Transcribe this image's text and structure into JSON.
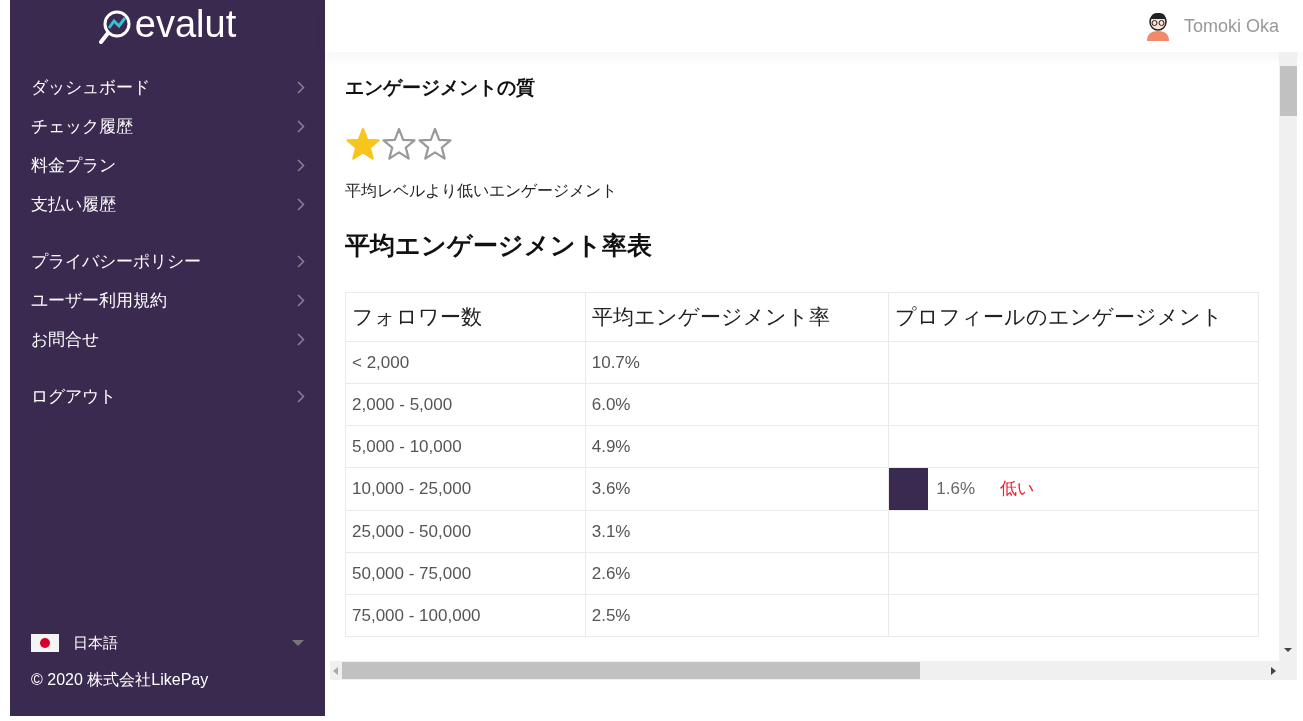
{
  "sidebar": {
    "logo": "evalut",
    "nav_groups": [
      [
        {
          "label": "ダッシュボード"
        },
        {
          "label": "チェック履歴"
        },
        {
          "label": "料金プラン"
        },
        {
          "label": "支払い履歴"
        }
      ],
      [
        {
          "label": "プライバシーポリシー"
        },
        {
          "label": "ユーザー利用規約"
        },
        {
          "label": "お問合せ"
        }
      ],
      [
        {
          "label": "ログアウト"
        }
      ]
    ],
    "language": "日本語",
    "copyright": "© 2020 株式会社LikePay"
  },
  "header": {
    "user_name": "Tomoki Oka"
  },
  "quality": {
    "title": "エンゲージメントの質",
    "stars": 1,
    "description": "平均レベルより低いエンゲージメント"
  },
  "table": {
    "title": "平均エンゲージメント率表",
    "columns": [
      "フォロワー数",
      "平均エンゲージメント率",
      "プロフィールのエンゲージメント"
    ],
    "rows": [
      {
        "followers": "< 2,000",
        "average": "10.7%"
      },
      {
        "followers": "2,000 - 5,000",
        "average": "6.0%"
      },
      {
        "followers": "5,000 - 10,000",
        "average": "4.9%"
      },
      {
        "followers": "10,000 - 25,000",
        "average": "3.6%",
        "profile": {
          "value": "1.6%",
          "verdict": "低い"
        }
      },
      {
        "followers": "25,000 - 50,000",
        "average": "3.1%"
      },
      {
        "followers": "50,000 - 75,000",
        "average": "2.6%"
      },
      {
        "followers": "75,000 - 100,000",
        "average": "2.5%"
      }
    ]
  }
}
